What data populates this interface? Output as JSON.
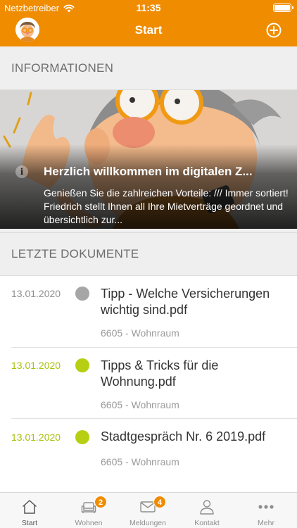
{
  "status_bar": {
    "carrier": "Netzbetreiber",
    "time": "11:35"
  },
  "header": {
    "title": "Start",
    "avatar_icon": "avatar-icon",
    "add_icon": "plus-circle-icon"
  },
  "colors": {
    "brand": "#f08c00",
    "dot_grey": "#a6a6a6",
    "dot_green": "#b7cf12",
    "date_green": "#a9c20a"
  },
  "sections": {
    "info_heading": "INFORMATIONEN",
    "docs_heading": "LETZTE DOKUMENTE"
  },
  "banner": {
    "title": "Herzlich willkommen im digitalen Z...",
    "text": "Genießen Sie die zahlreichen Vorteile: /// Immer sortiert! Friedrich stellt Ihnen all Ihre Mietverträge geordnet und übersichtlich zur...",
    "info_icon": "info-icon"
  },
  "documents": [
    {
      "date": "13.01.2020",
      "status": "read",
      "title": "Tipp - Welche Versicherungen wichtig sind.pdf",
      "subtitle": "6605 - Wohnraum"
    },
    {
      "date": "13.01.2020",
      "status": "new",
      "title": "Tipps & Tricks für die Wohnung.pdf",
      "subtitle": "6605 - Wohnraum"
    },
    {
      "date": "13.01.2020",
      "status": "new",
      "title": "Stadtgespräch Nr. 6 2019.pdf",
      "subtitle": "6605 - Wohnraum"
    }
  ],
  "tabbar": {
    "items": [
      {
        "label": "Start",
        "icon": "home-icon",
        "active": true,
        "badge": ""
      },
      {
        "label": "Wohnen",
        "icon": "sofa-icon",
        "active": false,
        "badge": "2"
      },
      {
        "label": "Meldungen",
        "icon": "mail-icon",
        "active": false,
        "badge": "4"
      },
      {
        "label": "Kontakt",
        "icon": "person-icon",
        "active": false,
        "badge": ""
      },
      {
        "label": "Mehr",
        "icon": "more-icon",
        "active": false,
        "badge": ""
      }
    ]
  }
}
